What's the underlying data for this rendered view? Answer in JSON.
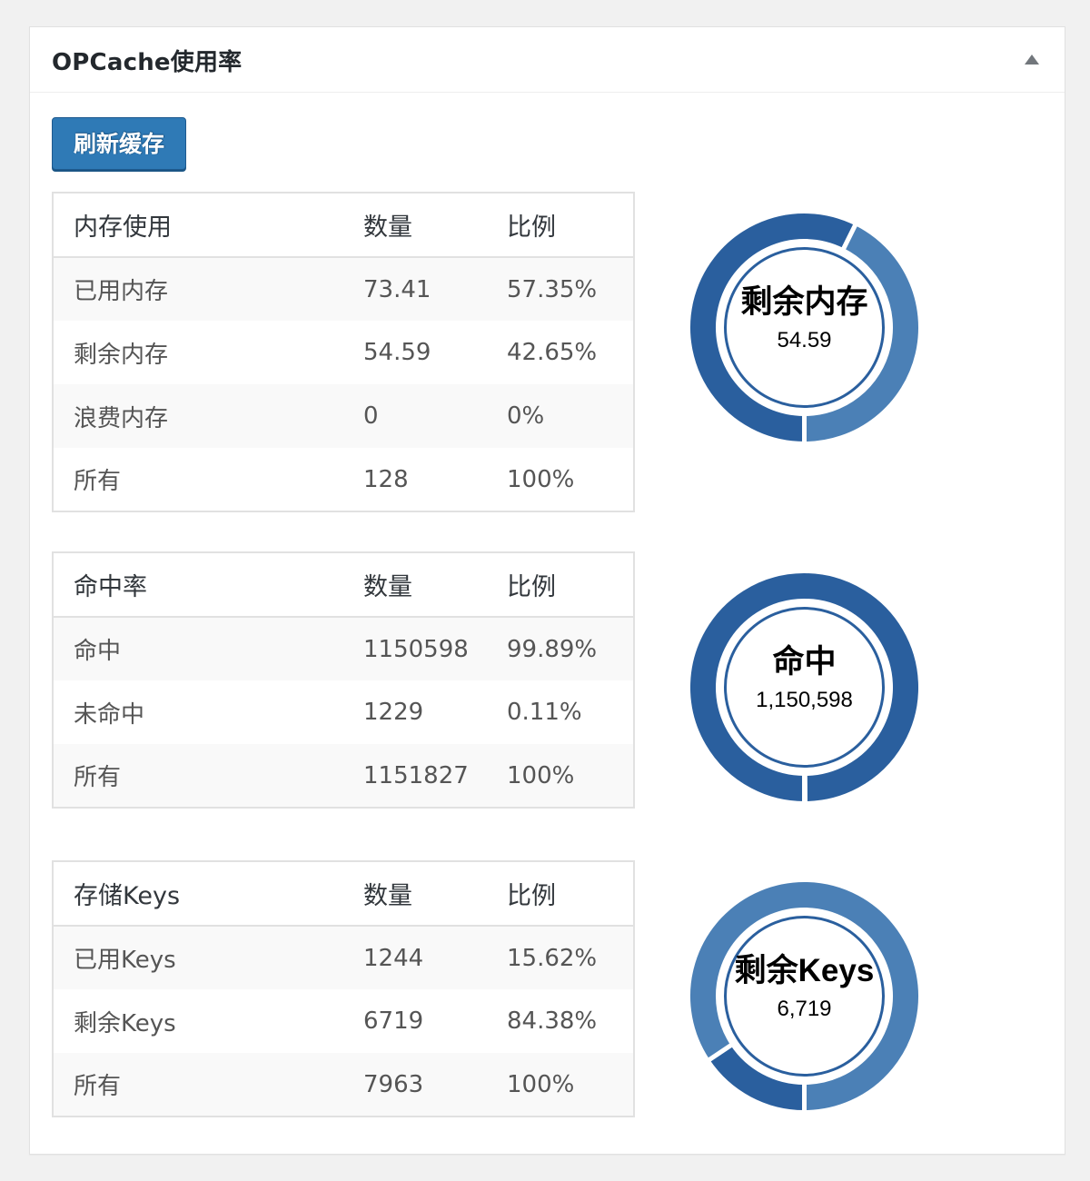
{
  "widget": {
    "title": "OPCache使用率",
    "refresh_button": "刷新缓存"
  },
  "memory": {
    "headers": [
      "内存使用",
      "数量",
      "比例"
    ],
    "rows": [
      [
        "已用内存",
        "73.41",
        "57.35%"
      ],
      [
        "剩余内存",
        "54.59",
        "42.65%"
      ],
      [
        "浪费内存",
        "0",
        "0%"
      ],
      [
        "所有",
        "128",
        "100%"
      ]
    ],
    "chart": {
      "label": "剩余内存",
      "value": "54.59",
      "slices": [
        {
          "value": 57.35,
          "color": "#2a5f9e"
        },
        {
          "value": 42.65,
          "color": "#4b80b6"
        },
        {
          "value": 0,
          "color": "#3b6fa8"
        }
      ]
    }
  },
  "hits": {
    "headers": [
      "命中率",
      "数量",
      "比例"
    ],
    "rows": [
      [
        "命中",
        "1150598",
        "99.89%"
      ],
      [
        "未命中",
        "1229",
        "0.11%"
      ],
      [
        "所有",
        "1151827",
        "100%"
      ]
    ],
    "chart": {
      "label": "命中",
      "value": "1,150,598",
      "slices": [
        {
          "value": 99.89,
          "color": "#2a5f9e"
        },
        {
          "value": 0.11,
          "color": "#4b80b6"
        }
      ]
    }
  },
  "keys": {
    "headers": [
      "存储Keys",
      "数量",
      "比例"
    ],
    "rows": [
      [
        "已用Keys",
        "1244",
        "15.62%"
      ],
      [
        "剩余Keys",
        "6719",
        "84.38%"
      ],
      [
        "所有",
        "7963",
        "100%"
      ]
    ],
    "chart": {
      "label": "剩余Keys",
      "value": "6,719",
      "slices": [
        {
          "value": 15.62,
          "color": "#2a5f9e"
        },
        {
          "value": 84.38,
          "color": "#4b80b6"
        }
      ]
    }
  }
}
